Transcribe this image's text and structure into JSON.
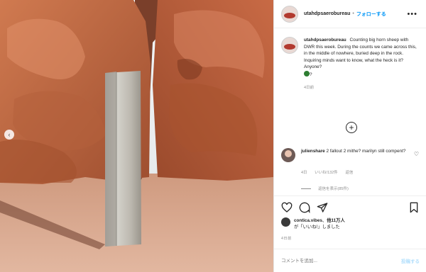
{
  "header": {
    "username": "utahdpsaerobureau",
    "separator": "•",
    "follow_label": "フォローする",
    "more_icon": "more-horizontal-icon"
  },
  "caption": {
    "username": "utahdpsaerobureau",
    "text": "Counting big horn sheep with DWR this week. During the counts we came across this, in the middle of nowhere, buried deep in the rock. Inquiring minds want to know, what the heck is it? Anyone?",
    "emoji": "globe-icon",
    "emoji_suffix": "?",
    "time_ago": "4日前"
  },
  "comment": {
    "username": "julienshare",
    "text": "2 fallout 2 mithe? marilyn still compent?",
    "meta": [
      "4日",
      "いいね!132件",
      "返信"
    ],
    "replies": "返信を表示(85件)"
  },
  "likes": {
    "user": "contica.vibes",
    "rest": "他11万人",
    "line2": "が「いいね!」しました"
  },
  "date": "4日前",
  "add_comment": {
    "placeholder": "コメントを追加...",
    "post_label": "投稿する"
  },
  "colors": {
    "accent": "#0095f6",
    "rock": "#c4704b",
    "sand": "#d9a286",
    "monolith": "#b8b6ae"
  }
}
